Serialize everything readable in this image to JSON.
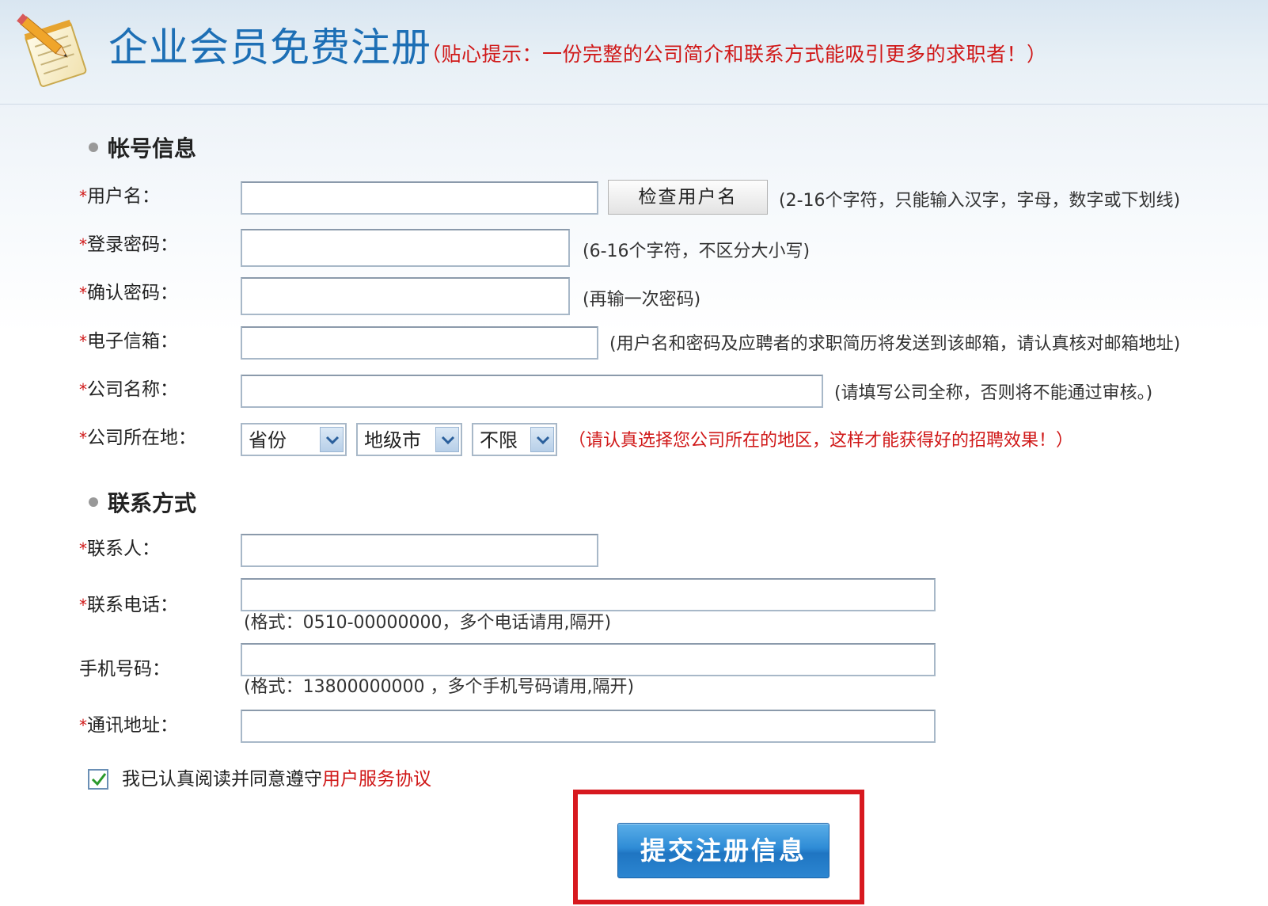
{
  "header": {
    "title": "企业会员免费注册",
    "tip": "（贴心提示：一份完整的公司简介和联系方式能吸引更多的求职者！）"
  },
  "account_section": {
    "heading": "帐号信息",
    "required_mark": "*",
    "username": {
      "label": "用户名：",
      "value": "",
      "check_button": "检查用户名",
      "hint": "(2-16个字符，只能输入汉字，字母，数字或下划线)"
    },
    "password": {
      "label": "登录密码：",
      "value": "",
      "hint": "(6-16个字符，不区分大小写)"
    },
    "confirm_password": {
      "label": "确认密码：",
      "value": "",
      "hint": "(再输一次密码)"
    },
    "email": {
      "label": "电子信箱：",
      "value": "",
      "hint": "(用户名和密码及应聘者的求职简历将发送到该邮箱，请认真核对邮箱地址)"
    },
    "company_name": {
      "label": "公司名称：",
      "value": "",
      "hint": "(请填写公司全称，否则将不能通过审核。)"
    },
    "location": {
      "label": "公司所在地：",
      "province": "省份",
      "city": "地级市",
      "district": "不限",
      "hint": "（请认真选择您公司所在的地区，这样才能获得好的招聘效果！）"
    }
  },
  "contact_section": {
    "heading": "联系方式",
    "contact_person": {
      "label": "联系人：",
      "value": ""
    },
    "phone": {
      "label": "联系电话：",
      "value": "",
      "hint": "(格式：0510-00000000，多个电话请用,隔开)"
    },
    "mobile": {
      "label": "手机号码：",
      "value": "",
      "hint": "(格式：13800000000 ，多个手机号码请用,隔开)"
    },
    "address": {
      "label": "通讯地址：",
      "value": ""
    }
  },
  "agreement": {
    "checked": true,
    "text": "我已认真阅读并同意遵守",
    "link": "用户服务协议"
  },
  "submit": {
    "label": "提交注册信息"
  },
  "colors": {
    "title_blue": "#1d6fb5",
    "alert_red": "#d01818",
    "button_blue": "#2f8cd6",
    "highlight_red": "#d7191f"
  },
  "icons": {
    "logo": "notepad-pencil-icon",
    "dropdown": "chevron-down-icon",
    "checkbox": "checkmark-icon"
  }
}
